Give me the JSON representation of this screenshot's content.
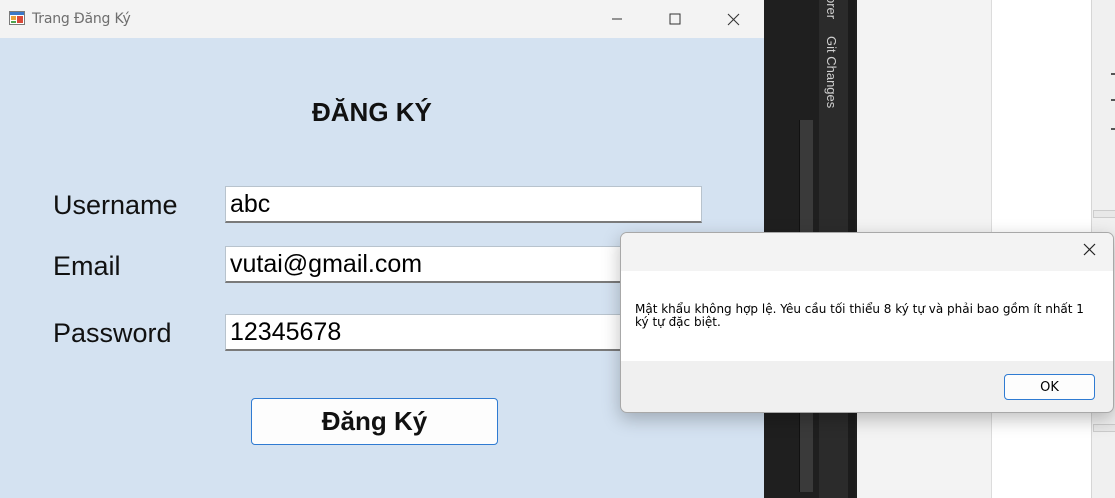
{
  "window": {
    "title": "Trang Đăng Ký"
  },
  "form": {
    "heading": "ĐĂNG KÝ",
    "username_label": "Username",
    "username_value": "abc",
    "email_label": "Email",
    "email_value": "vutai@gmail.com",
    "password_label": "Password",
    "password_value": "12345678",
    "submit_label": "Đăng Ký"
  },
  "dialog": {
    "message": "Mật khẩu không hợp lệ. Yêu cầu tối thiểu 8 ký tự và phải bao gồm ít nhất 1 ký tự đặc biệt.",
    "ok_label": "OK"
  },
  "ide": {
    "side_tab_1": "orer",
    "side_tab_2": "Git Changes"
  },
  "icons": {
    "app": "app-window-icon",
    "minimize": "minimize-icon",
    "maximize": "maximize-icon",
    "close": "close-icon"
  }
}
